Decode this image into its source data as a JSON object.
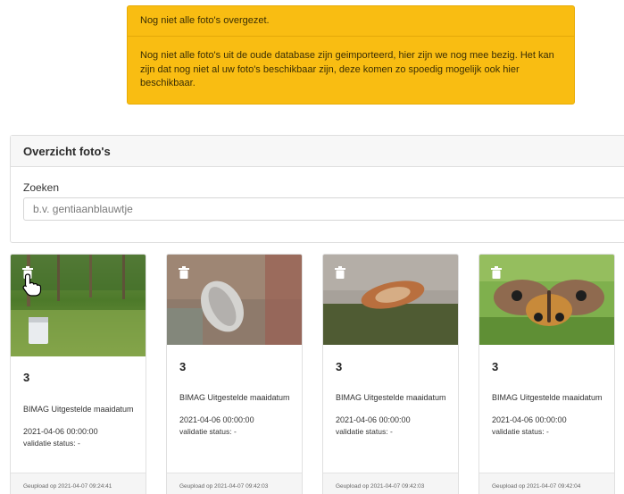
{
  "alert": {
    "heading": "Nog niet alle foto's overgezet.",
    "body": "Nog niet alle foto's uit de oude database zijn geimporteerd, hier zijn we nog mee bezig. Het kan zijn dat nog niet al uw foto's beschikbaar zijn, deze komen zo spoedig mogelijk ook hier beschikbaar."
  },
  "overview": {
    "title": "Overzicht foto's",
    "search_label": "Zoeken",
    "search_placeholder": "b.v. gentiaanblauwtje",
    "search_value": ""
  },
  "photos": [
    {
      "title": "3",
      "name": "BIMAG Uitgestelde maaidatum",
      "date": "2021-04-06 00:00:00",
      "status": "validatie status: -",
      "uploaded": "Geupload op 2021-04-07 09:24:41",
      "icon": "trash-icon"
    },
    {
      "title": "3",
      "name": "BIMAG Uitgestelde maaidatum",
      "date": "2021-04-06 00:00:00",
      "status": "validatie status: -",
      "uploaded": "Geupload op 2021-04-07 09:42:03",
      "icon": "trash-icon"
    },
    {
      "title": "3",
      "name": "BIMAG Uitgestelde maaidatum",
      "date": "2021-04-06 00:00:00",
      "status": "validatie status: -",
      "uploaded": "Geupload op 2021-04-07 09:42:03",
      "icon": "trash-icon"
    },
    {
      "title": "3",
      "name": "BIMAG Uitgestelde maaidatum",
      "date": "2021-04-06 00:00:00",
      "status": "validatie status: -",
      "uploaded": "Geupload op 2021-04-07 09:42:04",
      "icon": "trash-icon"
    }
  ],
  "colors": {
    "alert_bg": "#f9bd12",
    "card_header_bg": "#f7f7f7",
    "footer_bg": "#f5f5f5"
  }
}
